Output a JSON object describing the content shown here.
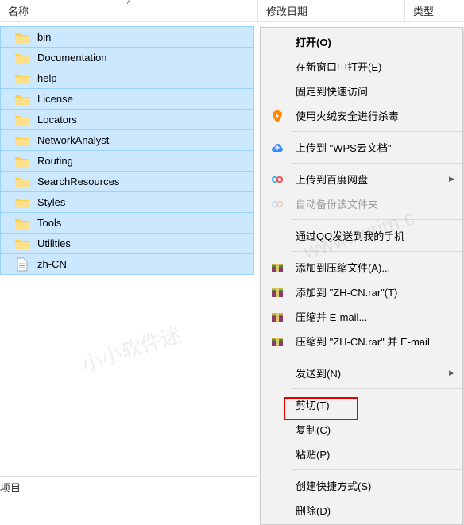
{
  "columns": {
    "name": "名称",
    "date": "修改日期",
    "type": "类型"
  },
  "files": [
    {
      "name": "bin",
      "kind": "folder"
    },
    {
      "name": "Documentation",
      "kind": "folder"
    },
    {
      "name": "help",
      "kind": "folder"
    },
    {
      "name": "License",
      "kind": "folder"
    },
    {
      "name": "Locators",
      "kind": "folder"
    },
    {
      "name": "NetworkAnalyst",
      "kind": "folder"
    },
    {
      "name": "Routing",
      "kind": "folder"
    },
    {
      "name": "SearchResources",
      "kind": "folder"
    },
    {
      "name": "Styles",
      "kind": "folder"
    },
    {
      "name": "Tools",
      "kind": "folder"
    },
    {
      "name": "Utilities",
      "kind": "folder"
    },
    {
      "name": "zh-CN",
      "kind": "file"
    }
  ],
  "menu": {
    "open": "打开(O)",
    "open_new_window": "在新窗口中打开(E)",
    "pin_quick_access": "固定到快速访问",
    "huorong_scan": "使用火绒安全进行杀毒",
    "upload_wps": "上传到 \"WPS云文档\"",
    "upload_baidu": "上传到百度网盘",
    "auto_backup": "自动备份该文件夹",
    "send_qq_phone": "通过QQ发送到我的手机",
    "rar_add": "添加到压缩文件(A)...",
    "rar_add_named": "添加到 \"ZH-CN.rar\"(T)",
    "rar_email": "压缩并 E-mail...",
    "rar_email_named": "压缩到 \"ZH-CN.rar\" 并 E-mail",
    "send_to": "发送到(N)",
    "cut": "剪切(T)",
    "copy": "复制(C)",
    "paste": "粘贴(P)",
    "create_shortcut": "创建快捷方式(S)",
    "delete": "删除(D)"
  },
  "status": {
    "items_label": "项目"
  },
  "watermark": {
    "text1": "小小软件迷",
    "text2": "www.xxrjm.c"
  }
}
